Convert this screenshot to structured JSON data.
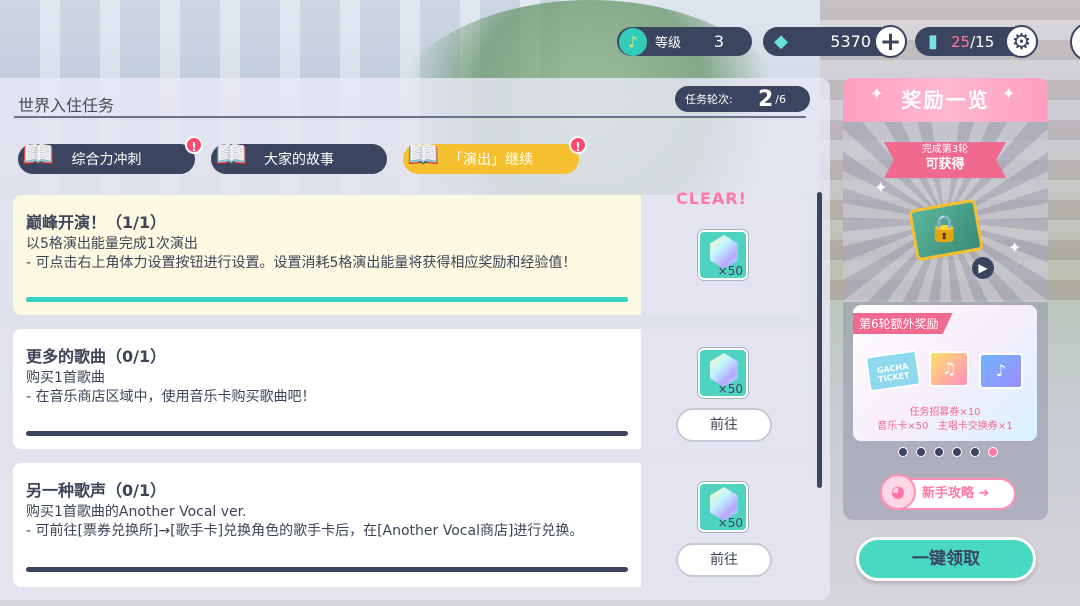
{
  "top_bar": {
    "level_label": "等级",
    "level_value": "3",
    "gems_value": "5370",
    "energy_current": "25",
    "energy_max": "/15"
  },
  "panel": {
    "title": "世界入住任务",
    "rounds_label": "任务轮次:",
    "rounds_current": "2",
    "rounds_total": "/6"
  },
  "tabs": [
    {
      "label": "综合力冲刺",
      "alert": "!"
    },
    {
      "label": "大家的故事"
    },
    {
      "label": "「演出」继续",
      "alert": "!"
    }
  ],
  "missions": [
    {
      "name": "巅峰开演！（1/1）",
      "desc": "以5格演出能量完成1次演出\n- 可点击右上角体力设置按钮进行设置。设置消耗5格演出能量将获得相应奖励和经验值！",
      "progress": 1.0,
      "reward_count": "×50",
      "status": "CLEAR!"
    },
    {
      "name": "更多的歌曲（0/1）",
      "desc": "购买1首歌曲\n- 在音乐商店区域中，使用音乐卡购买歌曲吧！",
      "progress": 0.0,
      "reward_count": "×50",
      "button": "前往"
    },
    {
      "name": "另一种歌声（0/1）",
      "desc": "购买1首歌曲的Another Vocal ver.\n- 可前往[票券兑换所]→[歌手卡]兑换角色的歌手卡后，在[Another Vocal商店]进行兑换。",
      "progress": 0.0,
      "reward_count": "×50",
      "button": "前往"
    }
  ],
  "rewards": {
    "header": "奖励一览",
    "ribbon_line1": "完成第3轮",
    "ribbon_line2": "可获得",
    "bonus_header": "第6轮额外奖励",
    "ticket_text": "GACHA TICKET",
    "bonus_line1": "任务招募券×10",
    "bonus_line2": "音乐卡×50   主唱卡交换券×1",
    "dots_total": 6,
    "dots_active": 6,
    "guide_label": "新手攻略",
    "claim_label": "一键领取"
  },
  "colors": {
    "navy": "#3c4560",
    "teal": "#33d4c4",
    "pink": "#ff77a8",
    "gold": "#f4c030"
  }
}
